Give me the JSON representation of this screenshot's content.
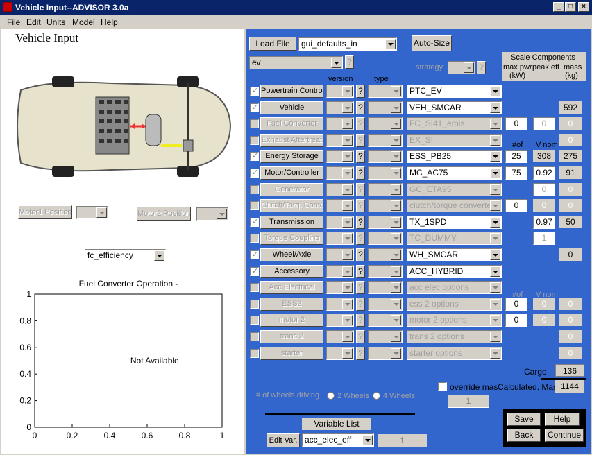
{
  "window": {
    "title": "Vehicle Input--ADVISOR 3.0a"
  },
  "menu": [
    "File",
    "Edit",
    "Units",
    "Model",
    "Help"
  ],
  "left": {
    "heading": "Vehicle Input",
    "motor1": "Motor1 Position",
    "motor2": "Motor2 Position",
    "plot_select": "fc_efficiency",
    "plot_title": "Fuel Converter Operation -",
    "plot_msg": "Not Available"
  },
  "chart_data": {
    "type": "line",
    "title": "Fuel Converter Operation -",
    "annotation": "Not Available",
    "xlim": [
      0,
      1
    ],
    "ylim": [
      0,
      1
    ],
    "xticks": [
      "0",
      "0.2",
      "0.4",
      "0.6",
      "0.8",
      "1"
    ],
    "yticks": [
      "0",
      "0.2",
      "0.4",
      "0.6",
      "0.8",
      "1"
    ],
    "series": []
  },
  "top": {
    "load_file": "Load File",
    "file_value": "gui_defaults_in",
    "auto_size": "Auto-Size",
    "drivetrain": "ev",
    "strategy": "strategy",
    "scale_title": "Scale Components",
    "max_pwr": "max pwr",
    "peak_eff": "peak eff",
    "kw": "(kW)",
    "mass": "mass",
    "kg": "(kg)",
    "version": "version",
    "type": "type",
    "q": "?",
    "nof": "#of",
    "vnom": "V nom"
  },
  "rows": [
    {
      "label": "Powertrain Control",
      "value": "PTC_EV",
      "enabled": true
    },
    {
      "label": "Vehicle",
      "value": "VEH_SMCAR",
      "enabled": true,
      "mass": "592"
    },
    {
      "label": "Fuel Converter",
      "value": "FC_SI41_emis",
      "enabled": false,
      "e1": "0",
      "e2": "0",
      "mass": "0"
    },
    {
      "label": "Exhaust Aftertreat",
      "value": "EX_SI",
      "enabled": false,
      "mass": "0"
    },
    {
      "label": "Energy Storage",
      "value": "ESS_PB25",
      "enabled": true,
      "e1": "25",
      "v2": "308",
      "mass": "275"
    },
    {
      "label": "Motor/Controller",
      "value": "MC_AC75",
      "enabled": true,
      "e1": "75",
      "e2": "0.92",
      "mass": "91"
    },
    {
      "label": "Generator",
      "value": "GC_ETA95",
      "enabled": false,
      "e2": "0",
      "mass": "0"
    },
    {
      "label": "Clutch/Torq. Conv.",
      "value": "clutch/torque converter",
      "enabled": false,
      "e1": "0",
      "v2": "0",
      "mass": "0"
    },
    {
      "label": "Transmission",
      "value": "TX_1SPD",
      "enabled": true,
      "e2": "0.97",
      "mass": "50"
    },
    {
      "label": "Torque Coupling",
      "value": "TC_DUMMY",
      "enabled": false,
      "e2": "1"
    },
    {
      "label": "Wheel/Axle",
      "value": "WH_SMCAR",
      "enabled": true,
      "mass": "0"
    },
    {
      "label": "Accessory",
      "value": "ACC_HYBRID",
      "enabled": true
    },
    {
      "label": "Acc Electrical",
      "value": "acc elec options",
      "enabled": false
    },
    {
      "label": "ESS2",
      "value": "ess 2 options",
      "enabled": false,
      "e1": "0",
      "v2": "0",
      "mass": "0"
    },
    {
      "label": "motor 2",
      "value": "motor 2 options",
      "enabled": false,
      "e1": "0",
      "v2": "0",
      "mass": "0"
    },
    {
      "label": "trans 2",
      "value": "trans 2 options",
      "enabled": false,
      "mass": "0"
    },
    {
      "label": "starter",
      "value": "starter options",
      "enabled": false,
      "mass": "0"
    }
  ],
  "bottom": {
    "cargo_label": "Cargo",
    "cargo": "136",
    "override": "override mas",
    "calc_label": "Calculated. Mass",
    "calc": "1144",
    "override_val": "1",
    "wheels_label": "# of wheels driving",
    "w2": "2 Wheels",
    "w4": "4 Wheels",
    "varlist": "Variable List",
    "editvar": "Edit Var.",
    "var_value": "acc_elec_eff",
    "var_num": "1",
    "save": "Save",
    "help": "Help",
    "back": "Back",
    "cont": "Continue"
  },
  "colors": {
    "panel": "#3366cc",
    "title": "#0a246a"
  }
}
